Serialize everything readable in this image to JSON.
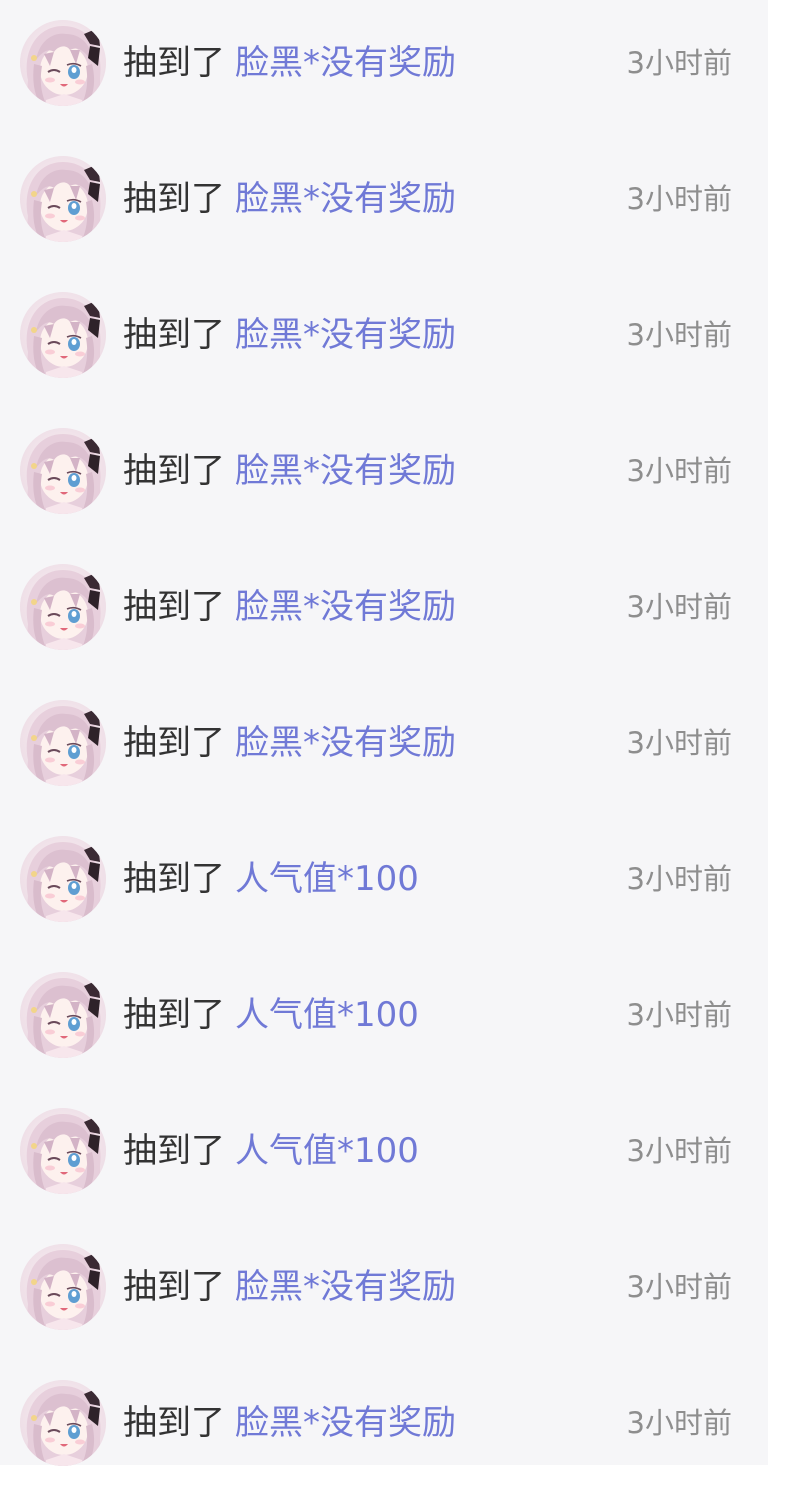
{
  "rows": [
    {
      "prefix": "抽到了",
      "prize": "脸黑*没有奖励",
      "time": "3小时前"
    },
    {
      "prefix": "抽到了",
      "prize": "脸黑*没有奖励",
      "time": "3小时前"
    },
    {
      "prefix": "抽到了",
      "prize": "脸黑*没有奖励",
      "time": "3小时前"
    },
    {
      "prefix": "抽到了",
      "prize": "脸黑*没有奖励",
      "time": "3小时前"
    },
    {
      "prefix": "抽到了",
      "prize": "脸黑*没有奖励",
      "time": "3小时前"
    },
    {
      "prefix": "抽到了",
      "prize": "脸黑*没有奖励",
      "time": "3小时前"
    },
    {
      "prefix": "抽到了",
      "prize": "人气值*100",
      "time": "3小时前"
    },
    {
      "prefix": "抽到了",
      "prize": "人气值*100",
      "time": "3小时前"
    },
    {
      "prefix": "抽到了",
      "prize": "人气值*100",
      "time": "3小时前"
    },
    {
      "prefix": "抽到了",
      "prize": "脸黑*没有奖励",
      "time": "3小时前"
    },
    {
      "prefix": "抽到了",
      "prize": "脸黑*没有奖励",
      "time": "3小时前"
    }
  ],
  "colors": {
    "panel_bg": "#f6f6f8",
    "prefix_text": "#333333",
    "prize_text": "#7079d6",
    "time_text": "#8e8e8e"
  },
  "icons": {
    "avatar": "anime-girl-avatar-icon"
  }
}
